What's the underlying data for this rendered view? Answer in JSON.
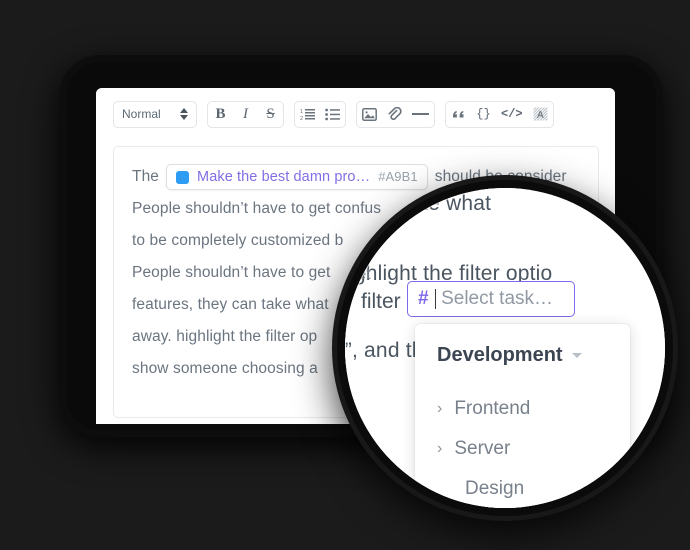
{
  "background_color": "#1b1b1b",
  "toolbar": {
    "style_select": {
      "value": "Normal",
      "icon": "updown-spinner-icon"
    },
    "groups": [
      {
        "name": "text-format",
        "buttons": [
          {
            "name": "bold-button",
            "label": "B"
          },
          {
            "name": "italic-button",
            "label": "I"
          },
          {
            "name": "strikethrough-button",
            "label": "S"
          }
        ]
      },
      {
        "name": "lists",
        "buttons": [
          {
            "name": "numbered-list-button",
            "label": "≡"
          },
          {
            "name": "bulleted-list-button",
            "label": "☰"
          }
        ]
      },
      {
        "name": "insert",
        "buttons": [
          {
            "name": "image-button",
            "label": "▣"
          },
          {
            "name": "attachment-button",
            "label": "ὑ7"
          },
          {
            "name": "horizontal-rule-button",
            "label": "—"
          }
        ]
      },
      {
        "name": "blocks",
        "buttons": [
          {
            "name": "blockquote-button",
            "label": "”"
          },
          {
            "name": "code-block-button",
            "label": "{}"
          },
          {
            "name": "inline-code-button",
            "label": "</>"
          },
          {
            "name": "clear-format-button",
            "label": "A"
          }
        ]
      }
    ]
  },
  "editor": {
    "lines": [
      {
        "prefix": "The",
        "suffix": "should be consider"
      },
      {
        "text": "People shouldn’t have to get confus"
      },
      {
        "text": "to be completely customized b"
      },
      {
        "text": "People shouldn’t have to get"
      },
      {
        "text": "features, they can take what"
      },
      {
        "text": "away. highlight the filter op"
      },
      {
        "text": "show someone choosing a"
      }
    ],
    "chip": {
      "color": "#2f9cf4",
      "title": "Make the best damn pro…",
      "id": "#A9B1"
    }
  },
  "magnifier": {
    "lines": [
      "can take what",
      ". highlight the filter optio",
      "ate”, and then show someone"
    ],
    "edge_fragments": [
      "get confus",
      "zed b",
      "get"
    ],
    "filter_word": "filter",
    "task_input": {
      "hash": "#",
      "placeholder": "Select task…",
      "value": "",
      "border_color": "#7c6ae8"
    },
    "dropdown": {
      "header": "Development",
      "items": [
        {
          "label": "Frontend",
          "arrow": "›",
          "expandable": true
        },
        {
          "label": "Server",
          "arrow": "›",
          "expandable": true
        },
        {
          "label": "Design",
          "arrow": "",
          "expandable": false
        }
      ]
    }
  }
}
